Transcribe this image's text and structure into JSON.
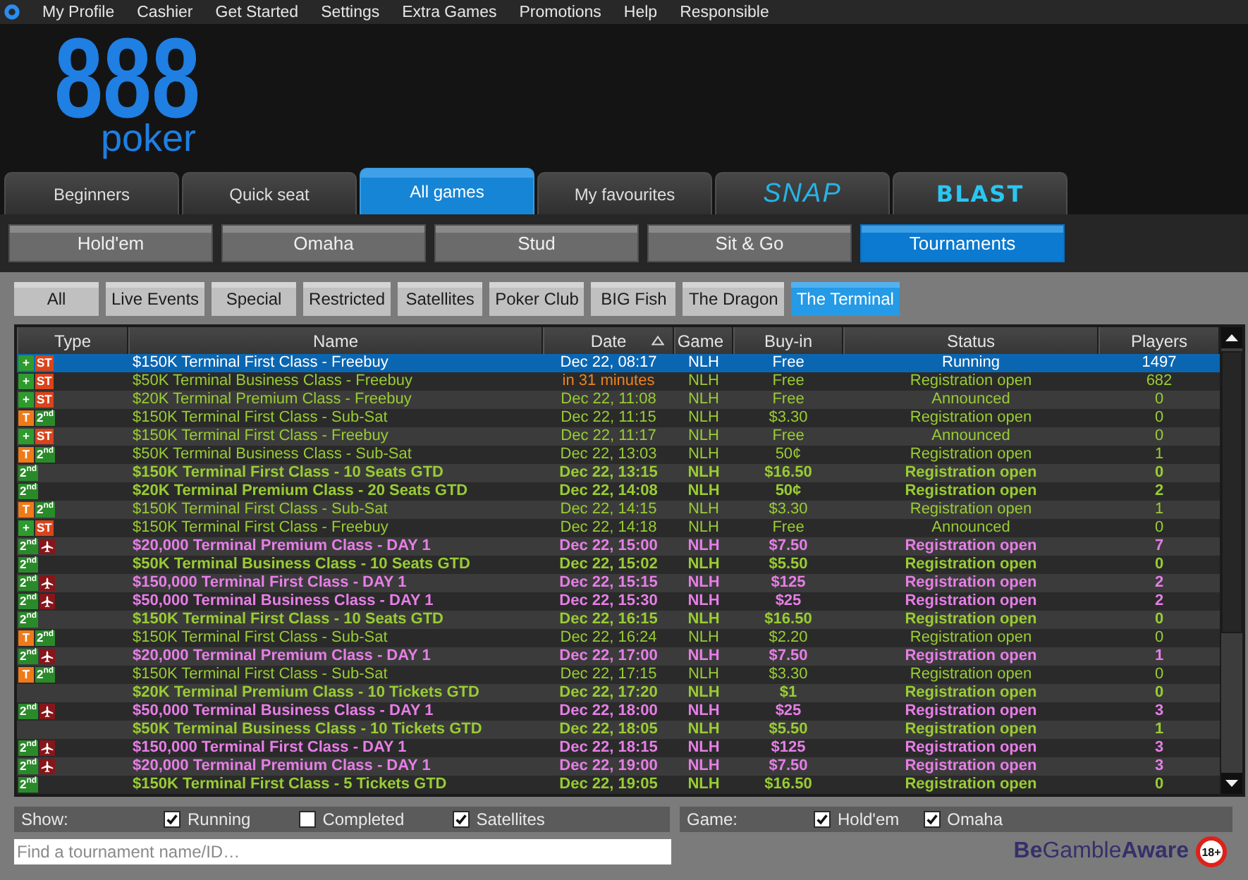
{
  "menu_bar": {
    "items": [
      "My Profile",
      "Cashier",
      "Get Started",
      "Settings",
      "Extra Games",
      "Promotions",
      "Help",
      "Responsible"
    ]
  },
  "logo": {
    "mark": "888",
    "wordmark": "poker"
  },
  "main_tabs": [
    {
      "label": "Beginners",
      "kind": "plain",
      "selected": false
    },
    {
      "label": "Quick seat",
      "kind": "plain",
      "selected": false
    },
    {
      "label": "All games",
      "kind": "plain",
      "selected": true
    },
    {
      "label": "My favourites",
      "kind": "plain",
      "selected": false
    },
    {
      "label": "SNAP",
      "kind": "italic",
      "selected": false
    },
    {
      "label": "BLAST",
      "kind": "heavy",
      "selected": false
    }
  ],
  "game_tabs": [
    {
      "label": "Hold'em",
      "selected": false
    },
    {
      "label": "Omaha",
      "selected": false
    },
    {
      "label": "Stud",
      "selected": false
    },
    {
      "label": "Sit & Go",
      "selected": false
    },
    {
      "label": "Tournaments",
      "selected": true
    }
  ],
  "filters": [
    {
      "label": "All",
      "selected": false
    },
    {
      "label": "Live Events",
      "selected": false
    },
    {
      "label": "Special",
      "selected": false
    },
    {
      "label": "Restricted",
      "selected": false
    },
    {
      "label": "Satellites",
      "selected": false
    },
    {
      "label": "Poker Club",
      "selected": false
    },
    {
      "label": "BIG Fish",
      "selected": false
    },
    {
      "label": "The Dragon",
      "selected": false
    },
    {
      "label": "The Terminal",
      "selected": true
    }
  ],
  "table": {
    "columns": [
      {
        "label": "Type",
        "sorted": false
      },
      {
        "label": "Name",
        "sorted": false
      },
      {
        "label": "Date",
        "sorted": true
      },
      {
        "label": "Game",
        "sorted": false
      },
      {
        "label": "Buy-in",
        "sorted": false
      },
      {
        "label": "Status",
        "sorted": false
      },
      {
        "label": "Players",
        "sorted": false
      }
    ],
    "rows": [
      {
        "badges": [
          {
            "kind": "text",
            "text": "+",
            "color": "#2e9b2e"
          },
          {
            "kind": "text",
            "text": "ST",
            "color": "#d9441c"
          }
        ],
        "name": "$150K Terminal First Class - Freebuy",
        "date": "Dec 22, 08:17",
        "date_highlighted": false,
        "game": "NLH",
        "buy_in": "Free",
        "status": "Running",
        "players": "1497",
        "bold": false,
        "selected": true
      },
      {
        "badges": [
          {
            "kind": "text",
            "text": "+",
            "color": "#2e9b2e"
          },
          {
            "kind": "text",
            "text": "ST",
            "color": "#d9441c"
          }
        ],
        "name": "$50K Terminal Business Class - Freebuy",
        "date": "in 31 minutes",
        "date_highlighted": true,
        "game": "NLH",
        "buy_in": "Free",
        "status": "Registration open",
        "players": "682",
        "bold": false,
        "color": "#99cc33",
        "selected": false
      },
      {
        "badges": [
          {
            "kind": "text",
            "text": "+",
            "color": "#2e9b2e"
          },
          {
            "kind": "text",
            "text": "ST",
            "color": "#d9441c"
          }
        ],
        "name": "$20K Terminal Premium Class - Freebuy",
        "date": "Dec 22, 11:08",
        "date_highlighted": false,
        "game": "NLH",
        "buy_in": "Free",
        "status": "Announced",
        "players": "0",
        "bold": false,
        "color": "#99cc33",
        "selected": false
      },
      {
        "badges": [
          {
            "kind": "text",
            "text": "T",
            "color": "#ee7a1a"
          },
          {
            "kind": "text",
            "text": "2$^{nd}$",
            "color": "#2a8a2a"
          }
        ],
        "name": "$150K Terminal First Class - Sub-Sat",
        "date": "Dec 22, 11:15",
        "date_highlighted": false,
        "game": "NLH",
        "buy_in": "$3.30",
        "status": "Registration open",
        "players": "0",
        "bold": false,
        "color": "#99cc33",
        "selected": false
      },
      {
        "badges": [
          {
            "kind": "text",
            "text": "+",
            "color": "#2e9b2e"
          },
          {
            "kind": "text",
            "text": "ST",
            "color": "#d9441c"
          }
        ],
        "name": "$150K Terminal First Class - Freebuy",
        "date": "Dec 22, 11:17",
        "date_highlighted": false,
        "game": "NLH",
        "buy_in": "Free",
        "status": "Announced",
        "players": "0",
        "bold": false,
        "color": "#99cc33",
        "selected": false
      },
      {
        "badges": [
          {
            "kind": "text",
            "text": "T",
            "color": "#ee7a1a"
          },
          {
            "kind": "text",
            "text": "2$^{nd}$",
            "color": "#2a8a2a"
          }
        ],
        "name": "$50K Terminal Business Class - Sub-Sat",
        "date": "Dec 22, 13:03",
        "date_highlighted": false,
        "game": "NLH",
        "buy_in": "50¢",
        "status": "Registration open",
        "players": "1",
        "bold": false,
        "color": "#99cc33",
        "selected": false
      },
      {
        "badges": [
          {
            "kind": "text",
            "text": "2$^{nd}$",
            "color": "#2a8a2a"
          }
        ],
        "name": "$150K Terminal First Class - 10 Seats GTD",
        "date": "Dec 22, 13:15",
        "date_highlighted": false,
        "game": "NLH",
        "buy_in": "$16.50",
        "status": "Registration open",
        "players": "0",
        "bold": true,
        "color": "#99cc33",
        "selected": false
      },
      {
        "badges": [
          {
            "kind": "text",
            "text": "2$^{nd}$",
            "color": "#2a8a2a"
          }
        ],
        "name": "$20K Terminal Premium Class - 20 Seats GTD",
        "date": "Dec 22, 14:08",
        "date_highlighted": false,
        "game": "NLH",
        "buy_in": "50¢",
        "status": "Registration open",
        "players": "2",
        "bold": true,
        "color": "#99cc33",
        "selected": false
      },
      {
        "badges": [
          {
            "kind": "text",
            "text": "T",
            "color": "#ee7a1a"
          },
          {
            "kind": "text",
            "text": "2$^{nd}$",
            "color": "#2a8a2a"
          }
        ],
        "name": "$150K Terminal First Class - Sub-Sat",
        "date": "Dec 22, 14:15",
        "date_highlighted": false,
        "game": "NLH",
        "buy_in": "$3.30",
        "status": "Registration open",
        "players": "1",
        "bold": false,
        "color": "#99cc33",
        "selected": false
      },
      {
        "badges": [
          {
            "kind": "text",
            "text": "+",
            "color": "#2e9b2e"
          },
          {
            "kind": "text",
            "text": "ST",
            "color": "#d9441c"
          }
        ],
        "name": "$150K Terminal First Class - Freebuy",
        "date": "Dec 22, 14:18",
        "date_highlighted": false,
        "game": "NLH",
        "buy_in": "Free",
        "status": "Announced",
        "players": "0",
        "bold": false,
        "color": "#99cc33",
        "selected": false
      },
      {
        "badges": [
          {
            "kind": "text",
            "text": "2$^{nd}$",
            "color": "#2a8a2a"
          },
          {
            "kind": "plane",
            "color": "#86161a"
          }
        ],
        "name": "$20,000 Terminal Premium Class - DAY 1",
        "date": "Dec 22, 15:00",
        "date_highlighted": false,
        "game": "NLH",
        "buy_in": "$7.50",
        "status": "Registration open",
        "players": "7",
        "bold": true,
        "color": "#e67ee6",
        "selected": false
      },
      {
        "badges": [
          {
            "kind": "text",
            "text": "2$^{nd}$",
            "color": "#2a8a2a"
          }
        ],
        "name": "$50K Terminal Business Class - 10 Seats GTD",
        "date": "Dec 22, 15:02",
        "date_highlighted": false,
        "game": "NLH",
        "buy_in": "$5.50",
        "status": "Registration open",
        "players": "0",
        "bold": true,
        "color": "#99cc33",
        "selected": false
      },
      {
        "badges": [
          {
            "kind": "text",
            "text": "2$^{nd}$",
            "color": "#2a8a2a"
          },
          {
            "kind": "plane",
            "color": "#86161a"
          }
        ],
        "name": "$150,000 Terminal First Class - DAY 1",
        "date": "Dec 22, 15:15",
        "date_highlighted": false,
        "game": "NLH",
        "buy_in": "$125",
        "status": "Registration open",
        "players": "2",
        "bold": true,
        "color": "#e67ee6",
        "selected": false
      },
      {
        "badges": [
          {
            "kind": "text",
            "text": "2$^{nd}$",
            "color": "#2a8a2a"
          },
          {
            "kind": "plane",
            "color": "#86161a"
          }
        ],
        "name": "$50,000 Terminal Business Class - DAY 1",
        "date": "Dec 22, 15:30",
        "date_highlighted": false,
        "game": "NLH",
        "buy_in": "$25",
        "status": "Registration open",
        "players": "2",
        "bold": true,
        "color": "#e67ee6",
        "selected": false
      },
      {
        "badges": [
          {
            "kind": "text",
            "text": "2$^{nd}$",
            "color": "#2a8a2a"
          }
        ],
        "name": "$150K Terminal First Class - 10 Seats GTD",
        "date": "Dec 22, 16:15",
        "date_highlighted": false,
        "game": "NLH",
        "buy_in": "$16.50",
        "status": "Registration open",
        "players": "0",
        "bold": true,
        "color": "#99cc33",
        "selected": false
      },
      {
        "badges": [
          {
            "kind": "text",
            "text": "T",
            "color": "#ee7a1a"
          },
          {
            "kind": "text",
            "text": "2$^{nd}$",
            "color": "#2a8a2a"
          }
        ],
        "name": "$150K Terminal First Class - Sub-Sat",
        "date": "Dec 22, 16:24",
        "date_highlighted": false,
        "game": "NLH",
        "buy_in": "$2.20",
        "status": "Registration open",
        "players": "0",
        "bold": false,
        "color": "#99cc33",
        "selected": false
      },
      {
        "badges": [
          {
            "kind": "text",
            "text": "2$^{nd}$",
            "color": "#2a8a2a"
          },
          {
            "kind": "plane",
            "color": "#86161a"
          }
        ],
        "name": "$20,000 Terminal Premium Class - DAY 1",
        "date": "Dec 22, 17:00",
        "date_highlighted": false,
        "game": "NLH",
        "buy_in": "$7.50",
        "status": "Registration open",
        "players": "1",
        "bold": true,
        "color": "#e67ee6",
        "selected": false
      },
      {
        "badges": [
          {
            "kind": "text",
            "text": "T",
            "color": "#ee7a1a"
          },
          {
            "kind": "text",
            "text": "2$^{nd}$",
            "color": "#2a8a2a"
          }
        ],
        "name": "$150K Terminal First Class - Sub-Sat",
        "date": "Dec 22, 17:15",
        "date_highlighted": false,
        "game": "NLH",
        "buy_in": "$3.30",
        "status": "Registration open",
        "players": "0",
        "bold": false,
        "color": "#99cc33",
        "selected": false
      },
      {
        "badges": [],
        "name": "$20K Terminal Premium Class - 10 Tickets GTD",
        "date": "Dec 22, 17:20",
        "date_highlighted": false,
        "game": "NLH",
        "buy_in": "$1",
        "status": "Registration open",
        "players": "0",
        "bold": true,
        "color": "#99cc33",
        "selected": false
      },
      {
        "badges": [
          {
            "kind": "text",
            "text": "2$^{nd}$",
            "color": "#2a8a2a"
          },
          {
            "kind": "plane",
            "color": "#86161a"
          }
        ],
        "name": "$50,000 Terminal Business Class - DAY 1",
        "date": "Dec 22, 18:00",
        "date_highlighted": false,
        "game": "NLH",
        "buy_in": "$25",
        "status": "Registration open",
        "players": "3",
        "bold": true,
        "color": "#e67ee6",
        "selected": false
      },
      {
        "badges": [],
        "name": "$50K Terminal Business Class - 10 Tickets GTD",
        "date": "Dec 22, 18:05",
        "date_highlighted": false,
        "game": "NLH",
        "buy_in": "$5.50",
        "status": "Registration open",
        "players": "1",
        "bold": true,
        "color": "#99cc33",
        "selected": false
      },
      {
        "badges": [
          {
            "kind": "text",
            "text": "2$^{nd}$",
            "color": "#2a8a2a"
          },
          {
            "kind": "plane",
            "color": "#86161a"
          }
        ],
        "name": "$150,000 Terminal First Class - DAY 1",
        "date": "Dec 22, 18:15",
        "date_highlighted": false,
        "game": "NLH",
        "buy_in": "$125",
        "status": "Registration open",
        "players": "3",
        "bold": true,
        "color": "#e67ee6",
        "selected": false
      },
      {
        "badges": [
          {
            "kind": "text",
            "text": "2$^{nd}$",
            "color": "#2a8a2a"
          },
          {
            "kind": "plane",
            "color": "#86161a"
          }
        ],
        "name": "$20,000 Terminal Premium Class - DAY 1",
        "date": "Dec 22, 19:00",
        "date_highlighted": false,
        "game": "NLH",
        "buy_in": "$7.50",
        "status": "Registration open",
        "players": "3",
        "bold": true,
        "color": "#e67ee6",
        "selected": false
      },
      {
        "badges": [
          {
            "kind": "text",
            "text": "2$^{nd}$",
            "color": "#2a8a2a"
          }
        ],
        "name": "$150K Terminal First Class - 5 Tickets GTD",
        "date": "Dec 22, 19:05",
        "date_highlighted": false,
        "game": "NLH",
        "buy_in": "$16.50",
        "status": "Registration open",
        "players": "0",
        "bold": true,
        "color": "#99cc33",
        "selected": false
      }
    ]
  },
  "show_filters": {
    "label": "Show:",
    "options": [
      {
        "label": "Running",
        "checked": true
      },
      {
        "label": "Completed",
        "checked": false
      },
      {
        "label": "Satellites",
        "checked": true
      }
    ]
  },
  "game_filters": {
    "label": "Game:",
    "options": [
      {
        "label": "Hold'em",
        "checked": true
      },
      {
        "label": "Omaha",
        "checked": true
      }
    ]
  },
  "search": {
    "placeholder": "Find a tournament name/ID…"
  },
  "footer": {
    "gamble_aware": "**Be**Gamble**Aware**",
    "age_badge": "18+"
  }
}
